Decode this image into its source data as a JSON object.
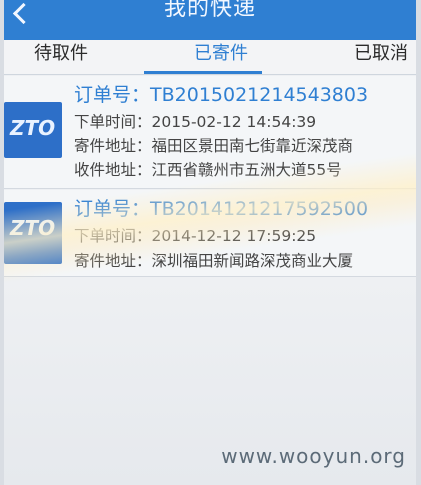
{
  "appbar": {
    "title": "我的快递"
  },
  "tabs": [
    {
      "label": "待取件"
    },
    {
      "label": "已寄件",
      "active": true
    },
    {
      "label": "已取消"
    }
  ],
  "orders": [
    {
      "logo": "ZTO",
      "order_label": "订单号：",
      "order_no": "TB2015021214543803",
      "time_label": "下单时间：",
      "time": "2015-02-12 14:54:39",
      "sender_label": "寄件地址：",
      "sender_addr": "福田区景田南七街靠近深茂商",
      "receiver_label": "收件地址：",
      "receiver_addr": "江西省赣州市五洲大道55号"
    },
    {
      "logo": "ZTO",
      "order_label": "订单号：",
      "order_no": "TB2014121217592500",
      "time_label": "下单时间：",
      "time": "2014-12-12 17:59:25",
      "sender_label": "寄件地址：",
      "sender_addr": "深圳福田新闻路深茂商业大厦"
    }
  ],
  "watermark": "www.wooyun.org",
  "colors": {
    "accent": "#2f7fd2",
    "logo_bg": "#2d6fc8"
  }
}
